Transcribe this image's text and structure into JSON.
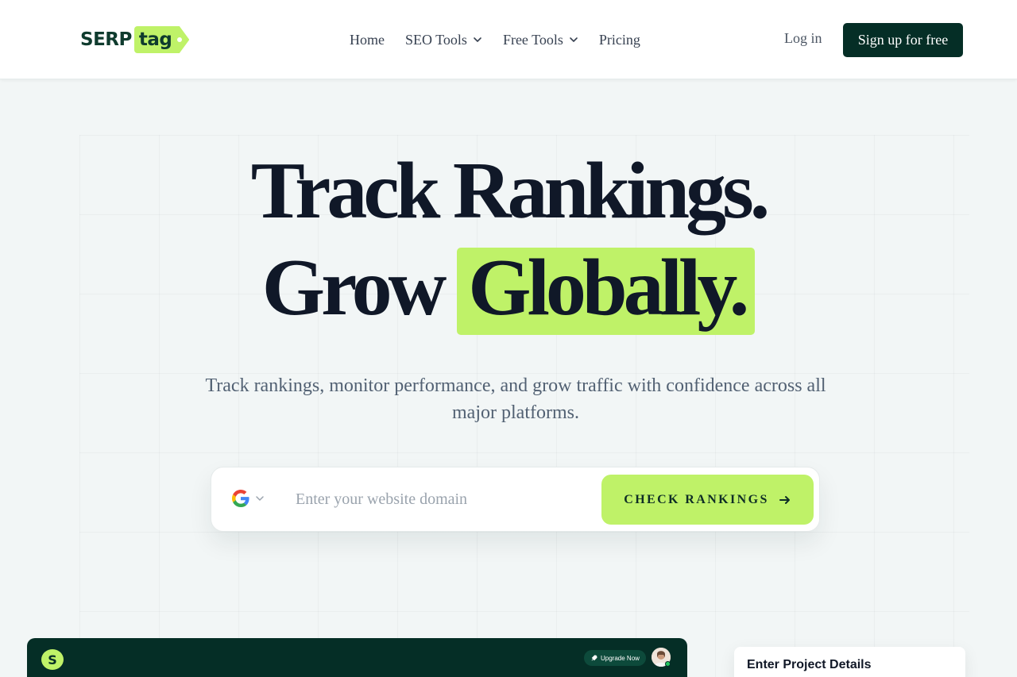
{
  "header": {
    "logo": {
      "part1": "SERP",
      "part2": "tag"
    },
    "nav": [
      {
        "label": "Home",
        "has_dropdown": false
      },
      {
        "label": "SEO Tools",
        "has_dropdown": true
      },
      {
        "label": "Free Tools",
        "has_dropdown": true
      },
      {
        "label": "Pricing",
        "has_dropdown": false
      }
    ],
    "login_label": "Log in",
    "signup_label": "Sign up for free"
  },
  "hero": {
    "title_line1": "Track Rankings.",
    "title_line2_plain": "Grow",
    "title_line2_highlight": "Globally.",
    "subtitle": "Track rankings, monitor performance, and grow traffic with confidence across all major platforms."
  },
  "search": {
    "engine_icon": "google-icon",
    "placeholder": "Enter your website domain",
    "value": "",
    "button_label": "CHECK RANKINGS",
    "button_icon": "arrow-right-icon"
  },
  "dashboard_preview": {
    "logo_letter": "S",
    "upgrade_label": "Upgrade Now",
    "upgrade_icon": "rocket-icon",
    "avatar_icon": "avatar"
  },
  "project_card": {
    "title": "Enter Project Details"
  },
  "colors": {
    "brand_dark": "#052e26",
    "brand_lime": "#bff268",
    "background": "#f2f6f6",
    "heading": "#101828",
    "body_text": "#526173"
  }
}
